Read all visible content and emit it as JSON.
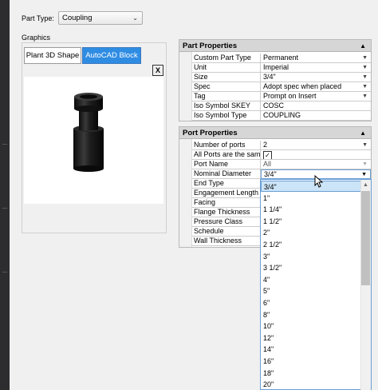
{
  "part_type": {
    "label": "Part Type:",
    "value": "Coupling"
  },
  "graphics": {
    "label": "Graphics",
    "tabs": [
      "Plant 3D Shape",
      "AutoCAD Block"
    ],
    "close_label": "X"
  },
  "part_properties": {
    "title": "Part Properties",
    "rows": [
      {
        "name": "Custom Part Type",
        "value": "Permanent"
      },
      {
        "name": "Unit",
        "value": "Imperial"
      },
      {
        "name": "Size",
        "value": "3/4\""
      },
      {
        "name": "Spec",
        "value": "Adopt spec when placed"
      },
      {
        "name": "Tag",
        "value": "Prompt on Insert"
      },
      {
        "name": "Iso Symbol SKEY",
        "value": "COSC"
      },
      {
        "name": "Iso Symbol Type",
        "value": "COUPLING"
      }
    ]
  },
  "port_properties": {
    "title": "Port Properties",
    "rows": [
      {
        "name": "Number of ports",
        "value": "2"
      },
      {
        "name": "All Ports are the same",
        "value": ""
      },
      {
        "name": "Port Name",
        "value": "All"
      },
      {
        "name": "Nominal Diameter",
        "value": "3/4\""
      },
      {
        "name": "End Type",
        "value": ""
      },
      {
        "name": "Engagement Length",
        "value": ""
      },
      {
        "name": "Facing",
        "value": ""
      },
      {
        "name": "Flange Thickness",
        "value": ""
      },
      {
        "name": "Pressure Class",
        "value": ""
      },
      {
        "name": "Schedule",
        "value": ""
      },
      {
        "name": "Wall Thickness",
        "value": ""
      }
    ],
    "all_ports_same_checked": true
  },
  "diameter_options": [
    "3/4\"",
    "1\"",
    "1 1/4\"",
    "1 1/2\"",
    "2\"",
    "2 1/2\"",
    "3\"",
    "3 1/2\"",
    "4\"",
    "5\"",
    "6\"",
    "8\"",
    "10\"",
    "12\"",
    "14\"",
    "16\"",
    "18\"",
    "20\""
  ],
  "selected_option_index": 0,
  "icons": {
    "dropdown": "chevron-down-icon",
    "collapse": "collapse-triangle-icon",
    "check": "checkmark-icon"
  }
}
